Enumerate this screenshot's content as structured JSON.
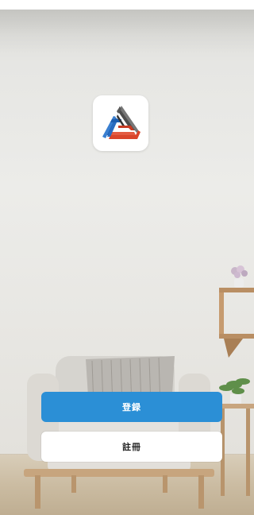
{
  "app": {
    "logo_icon": "triangle-logo-icon"
  },
  "buttons": {
    "login_label": "登録",
    "register_label": "註冊"
  },
  "colors": {
    "primary": "#2b8fd6",
    "secondary_bg": "#ffffff",
    "logo_red": "#d9452b",
    "logo_blue": "#1f5fb0",
    "logo_gray": "#555555"
  }
}
